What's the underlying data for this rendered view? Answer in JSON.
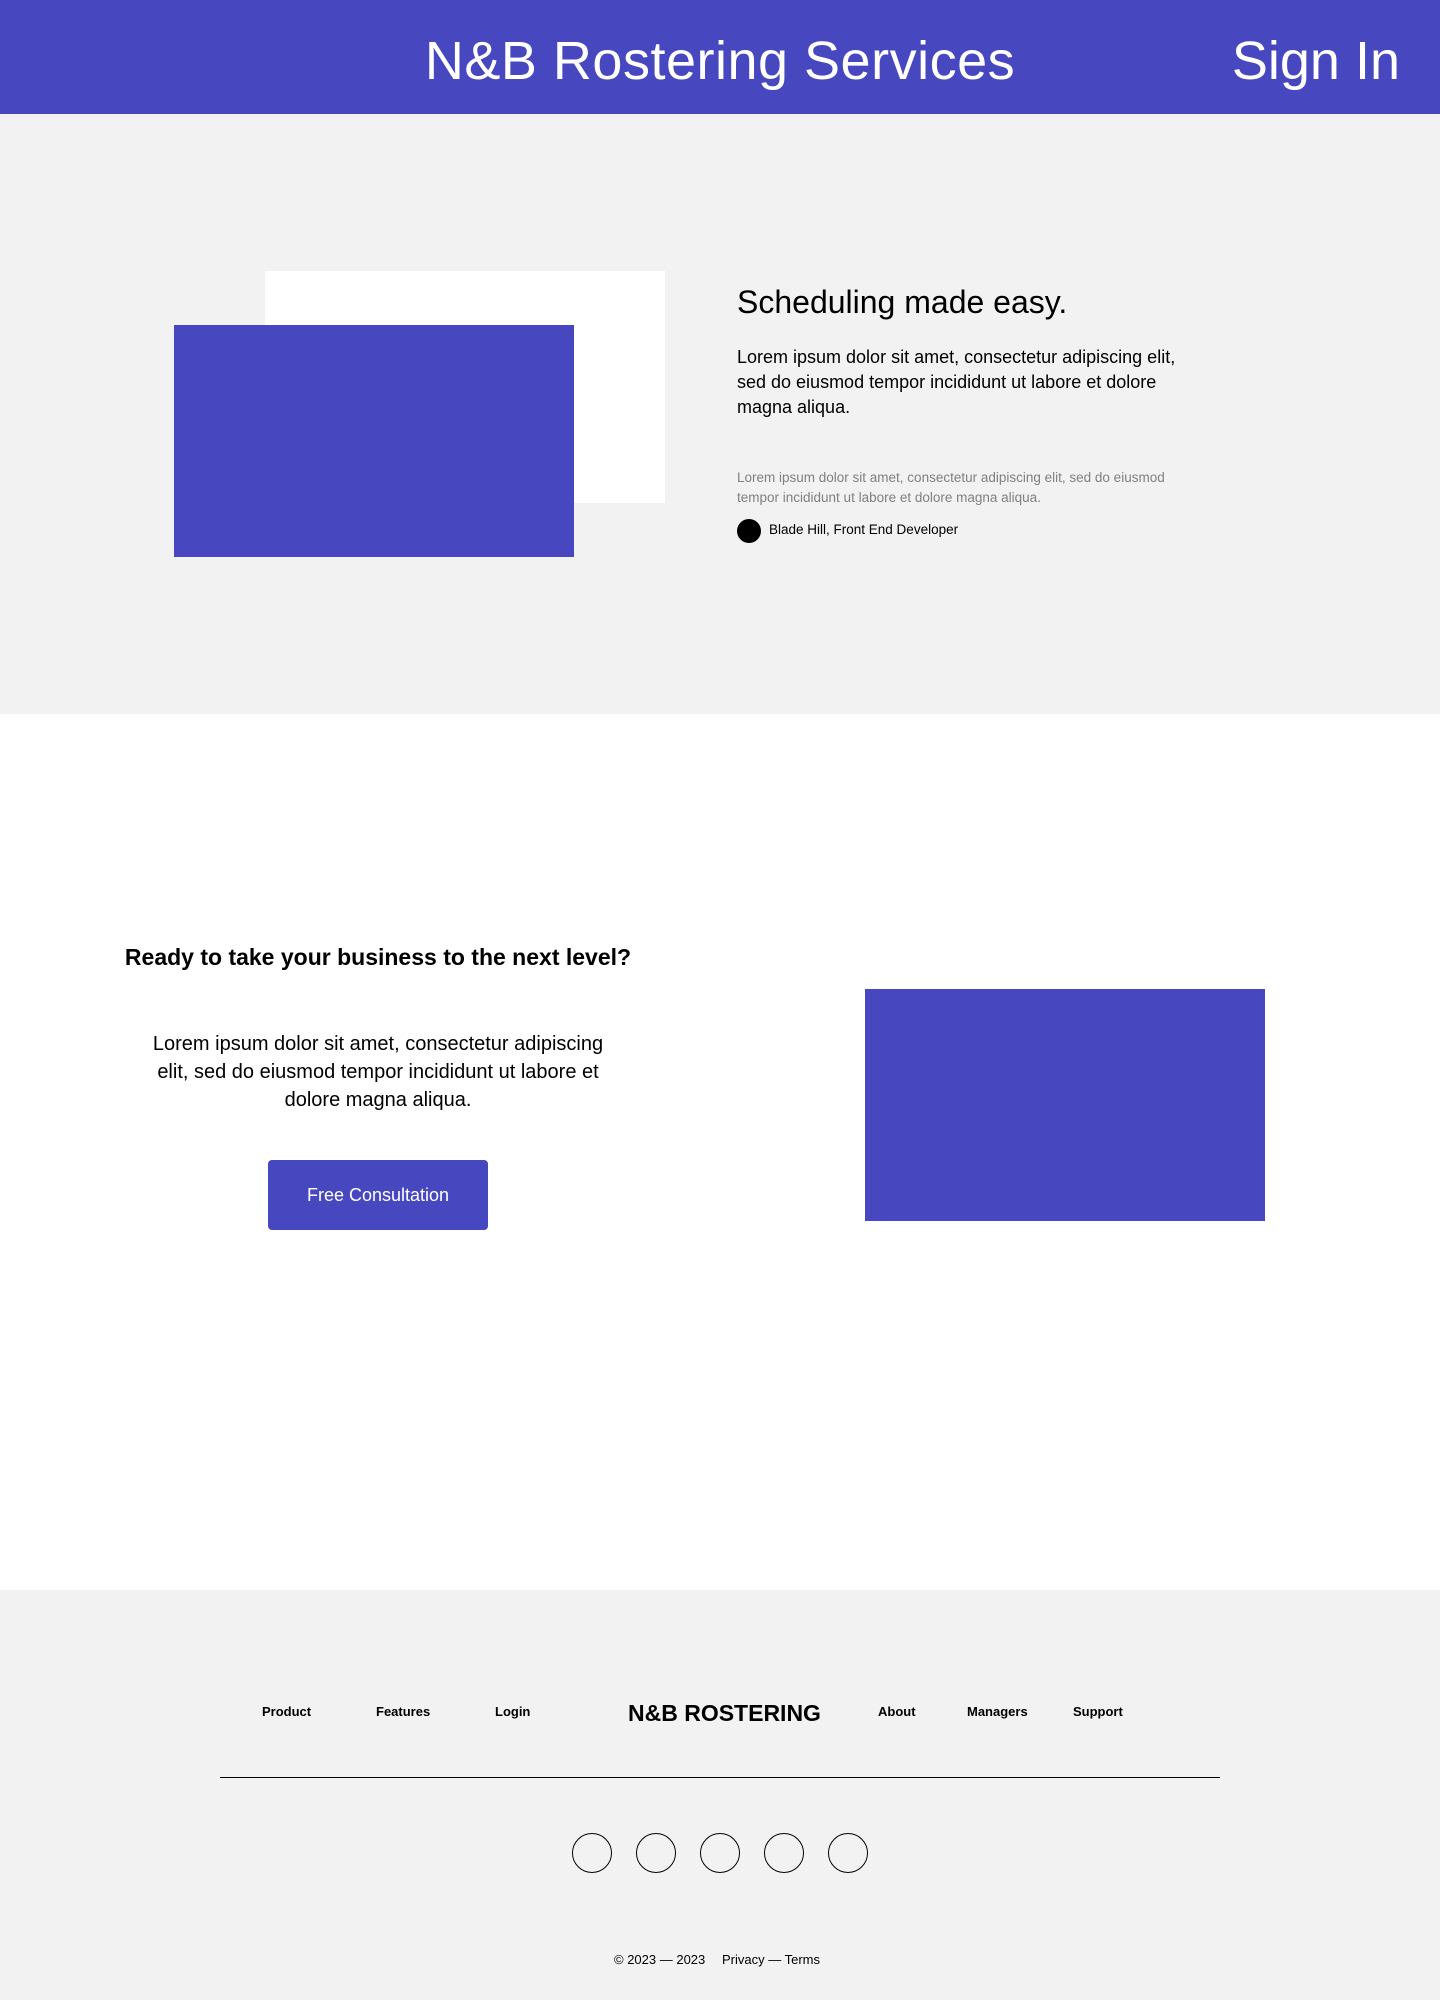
{
  "header": {
    "title": "N&B Rostering Services",
    "sign_in": "Sign In"
  },
  "hero": {
    "heading": "Scheduling made easy.",
    "text": "Lorem ipsum dolor sit amet, consectetur adipiscing elit, sed do eiusmod tempor incididunt ut labore et dolore magna aliqua.",
    "quote": "Lorem ipsum dolor sit amet, consectetur adipiscing elit, sed do eiusmod tempor incididunt ut labore et dolore magna aliqua.",
    "author": "Blade Hill, Front End Developer"
  },
  "cta": {
    "heading": "Ready to take your business to the next level?",
    "text": "Lorem ipsum dolor sit amet, consectetur adipiscing elit, sed do eiusmod tempor incididunt ut labore et dolore magna aliqua.",
    "button": "Free Consultation"
  },
  "footer": {
    "links_left": [
      "Product",
      "Features",
      "Login"
    ],
    "logo": "N&B ROSTERING",
    "links_right": [
      "About",
      "Managers",
      "Support"
    ],
    "copyright": "© 2023 — 2023",
    "legal": "Privacy — Terms"
  },
  "colors": {
    "brand": "#4747bf",
    "section_bg": "#f2f2f2"
  }
}
